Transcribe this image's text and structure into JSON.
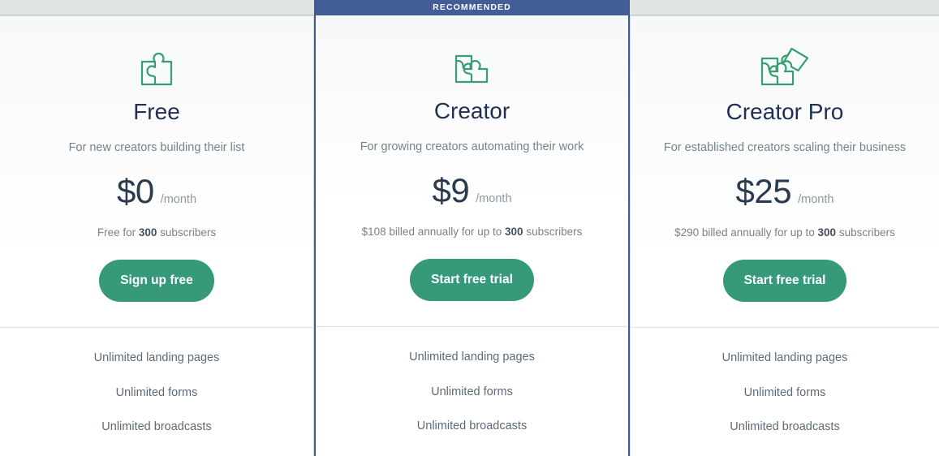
{
  "ribbon": {
    "label": "RECOMMENDED"
  },
  "colors": {
    "accent_green": "#35997a",
    "featured_blue": "#435d96",
    "featured_border": "#3d5a94",
    "icon_green": "#3a9e75",
    "title_navy": "#1f3050",
    "muted_gray": "#76828d",
    "page_band": "#dfe5e3"
  },
  "plans": [
    {
      "icon": "puzzle-one-piece-icon",
      "name": "Free",
      "tagline": "For new creators building their list",
      "price_amount": "$0",
      "price_period": "/month",
      "note_prefix": "Free for ",
      "note_bold": "300",
      "note_suffix": " subscribers",
      "cta_label": "Sign up free",
      "recommended": false,
      "features": [
        "Unlimited landing pages",
        "Unlimited forms",
        "Unlimited broadcasts"
      ]
    },
    {
      "icon": "puzzle-two-pieces-icon",
      "name": "Creator",
      "tagline": "For growing creators automating their work",
      "price_amount": "$9",
      "price_period": "/month",
      "note_prefix": "$108 billed annually for up to ",
      "note_bold": "300",
      "note_suffix": " subscribers",
      "cta_label": "Start free trial",
      "recommended": true,
      "features": [
        "Unlimited landing pages",
        "Unlimited forms",
        "Unlimited broadcasts"
      ]
    },
    {
      "icon": "puzzle-three-pieces-icon",
      "name": "Creator Pro",
      "tagline": "For established creators scaling their business",
      "price_amount": "$25",
      "price_period": "/month",
      "note_prefix": "$290 billed annually for up to ",
      "note_bold": "300",
      "note_suffix": " subscribers",
      "cta_label": "Start free trial",
      "recommended": false,
      "features": [
        "Unlimited landing pages",
        "Unlimited forms",
        "Unlimited broadcasts"
      ]
    }
  ]
}
